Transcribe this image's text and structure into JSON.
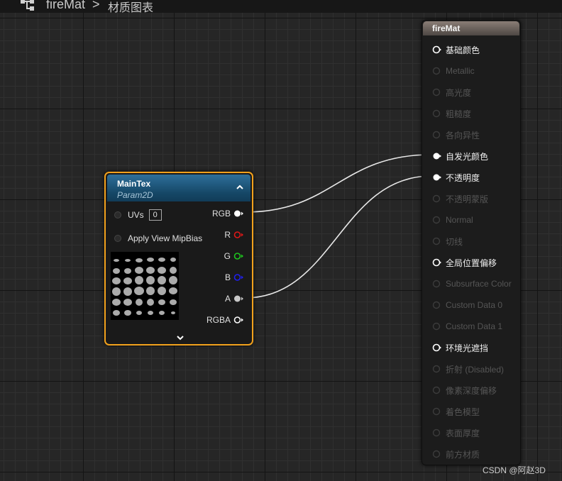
{
  "breadcrumb": {
    "root": "fireMat",
    "separator": ">",
    "page": "材质图表",
    "icon": "graph-icon"
  },
  "texture_node": {
    "title": "MainTex",
    "subtitle": "Param2D",
    "inputs": [
      {
        "label": "UVs",
        "value": "0"
      },
      {
        "label": "Apply View MipBias"
      }
    ],
    "outputs": [
      {
        "label": "RGB",
        "color": "#ffffff"
      },
      {
        "label": "R",
        "color": "#e01818"
      },
      {
        "label": "G",
        "color": "#1ec81e"
      },
      {
        "label": "B",
        "color": "#2020ee"
      },
      {
        "label": "A",
        "color": "#c8c8c8"
      },
      {
        "label": "RGBA",
        "color": "#ffffff"
      }
    ],
    "border_color": "#f2a11c",
    "header_color": "#1a5b84"
  },
  "material_node": {
    "title": "fireMat",
    "pins": [
      {
        "label": "基础颜色",
        "state": "open"
      },
      {
        "label": "Metallic",
        "state": "disabled"
      },
      {
        "label": "高光度",
        "state": "disabled"
      },
      {
        "label": "粗糙度",
        "state": "disabled"
      },
      {
        "label": "各向异性",
        "state": "disabled"
      },
      {
        "label": "自发光颜色",
        "state": "connected"
      },
      {
        "label": "不透明度",
        "state": "connected"
      },
      {
        "label": "不透明蒙版",
        "state": "disabled"
      },
      {
        "label": "Normal",
        "state": "disabled"
      },
      {
        "label": "切线",
        "state": "disabled"
      },
      {
        "label": "全局位置偏移",
        "state": "open"
      },
      {
        "label": "Subsurface Color",
        "state": "disabled"
      },
      {
        "label": "Custom Data 0",
        "state": "disabled"
      },
      {
        "label": "Custom Data 1",
        "state": "disabled"
      },
      {
        "label": "环境光遮挡",
        "state": "open"
      },
      {
        "label": "折射 (Disabled)",
        "state": "disabled"
      },
      {
        "label": "像素深度偏移",
        "state": "disabled"
      },
      {
        "label": "着色模型",
        "state": "disabled"
      },
      {
        "label": "表面厚度",
        "state": "disabled"
      },
      {
        "label": "前方材质",
        "state": "disabled"
      }
    ]
  },
  "connections": [
    {
      "from": "RGB",
      "to": "自发光颜色"
    },
    {
      "from": "A",
      "to": "不透明度"
    }
  ],
  "watermark": "CSDN @阿赵3D"
}
